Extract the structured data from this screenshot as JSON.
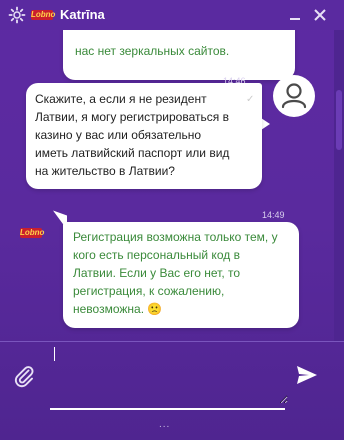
{
  "header": {
    "brand_logo_text": "Lobno",
    "agent_name": "Katrīna",
    "settings_icon": "gear-icon",
    "minimize_icon": "minus-icon",
    "close_icon": "close-icon"
  },
  "messages": [
    {
      "sender": "agent",
      "text": "нас нет зеркальных сайтов."
    },
    {
      "sender": "user",
      "time": "14:46",
      "lines": [
        "Скажите, а если я не резидент",
        "Латвии, я могу регистрироваться в",
        "казино у вас или обязательно",
        "иметь латвийский паспорт или вид",
        "на жительство в Латвии?"
      ],
      "status_icon": "check-icon"
    },
    {
      "sender": "agent",
      "time": "14:49",
      "lines": [
        "Регистрация возможна только тем, у",
        "кого есть персональный код в",
        "Латвии. Если у Вас его нет, то",
        "регистрация, к сожалению,",
        "невозможна. 🙁"
      ]
    }
  ],
  "composer": {
    "value": "",
    "placeholder": "",
    "attach_icon": "paperclip-icon",
    "send_icon": "send-icon",
    "resize_handle": "..."
  },
  "colors": {
    "background": "#5a2a9e",
    "bubble": "#ffffff",
    "agent_text": "#3a8a3a",
    "user_text": "#1f1f1f",
    "logo_red": "#c91f2e",
    "logo_yellow": "#ffd24a"
  }
}
